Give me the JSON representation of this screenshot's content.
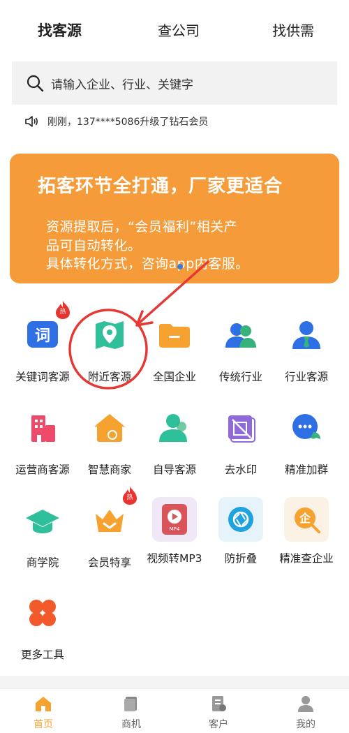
{
  "top_tabs": [
    {
      "label": "找客源"
    },
    {
      "label": "查公司"
    },
    {
      "label": "找供需"
    }
  ],
  "search": {
    "placeholder": "请输入企业、行业、关键字"
  },
  "notice": {
    "text": "刚刚，137****5086升级了钻石会员"
  },
  "banner": {
    "title": "拓客环节全打通，厂家更适合",
    "line1": "资源提取后，“会员福利”相关产",
    "line2": "品可自动转化。",
    "line3": "具体转化方式，咨询app内客服。"
  },
  "tools": [
    {
      "label": "关键词客源",
      "icon": "keyword-icon",
      "hot": true
    },
    {
      "label": "附近客源",
      "icon": "map-pin-icon",
      "hot": false
    },
    {
      "label": "全国企业",
      "icon": "folder-icon",
      "hot": false
    },
    {
      "label": "传统行业",
      "icon": "users-icon",
      "hot": false
    },
    {
      "label": "行业客源",
      "icon": "user-tie-icon",
      "hot": false
    },
    {
      "label": "运营商客源",
      "icon": "building-icon",
      "hot": false
    },
    {
      "label": "智慧商家",
      "icon": "shop-icon",
      "hot": false
    },
    {
      "label": "自导客源",
      "icon": "person-icon",
      "hot": false
    },
    {
      "label": "去水印",
      "icon": "watermark-icon",
      "hot": false
    },
    {
      "label": "精准加群",
      "icon": "chat-group-icon",
      "hot": false
    },
    {
      "label": "商学院",
      "icon": "graduation-cap-icon",
      "hot": false
    },
    {
      "label": "会员特享",
      "icon": "crown-icon",
      "hot": true
    },
    {
      "label": "视频转MP3",
      "icon": "video-play-icon",
      "hot": false
    },
    {
      "label": "防折叠",
      "icon": "aperture-icon",
      "hot": false
    },
    {
      "label": "精准查企业",
      "icon": "search-company-icon",
      "hot": false
    },
    {
      "label": "更多工具",
      "icon": "grid-more-icon",
      "hot": false
    }
  ],
  "hot_badge": "热",
  "icon_texts": {
    "keyword": "词",
    "mp4": "MP4",
    "company": "企"
  },
  "bottom_nav": [
    {
      "label": "首页",
      "icon": "home-icon"
    },
    {
      "label": "商机",
      "icon": "opportunity-icon"
    },
    {
      "label": "客户",
      "icon": "customer-icon"
    },
    {
      "label": "我的",
      "icon": "profile-icon"
    }
  ],
  "colors": {
    "accent": "#f5a230",
    "banner": "#f59b3a",
    "annotation_red": "#e53935"
  }
}
